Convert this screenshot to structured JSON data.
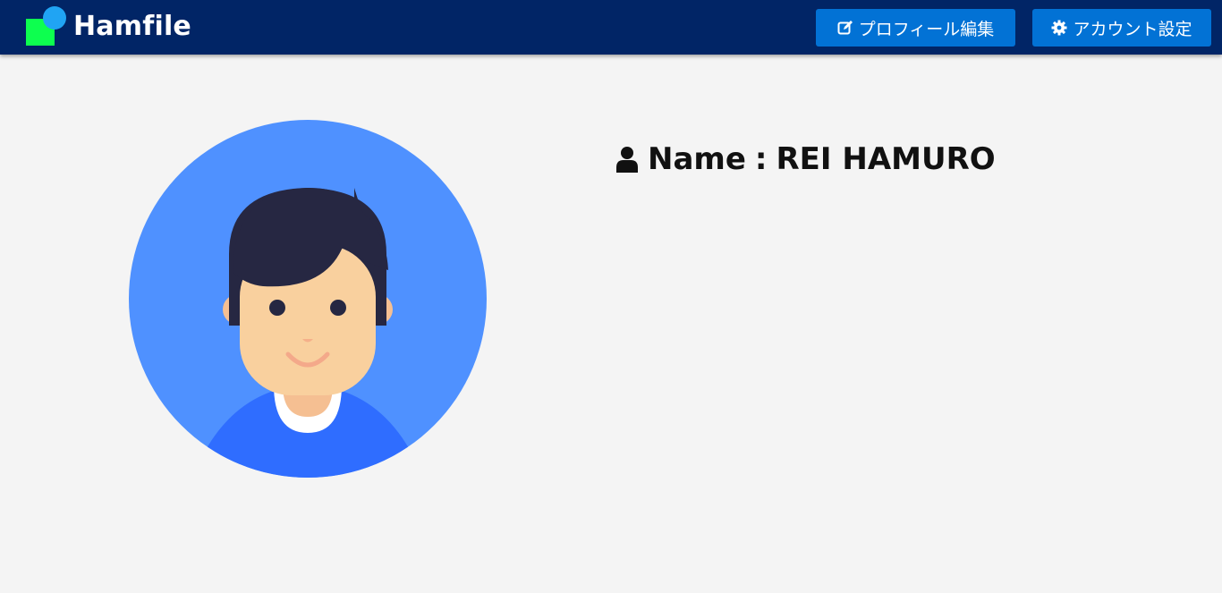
{
  "navbar": {
    "brand_name": "Hamfile",
    "edit_profile_label": "プロフィール編集",
    "edit_profile_icon": "pencil-square-icon",
    "account_settings_label": "アカウント設定",
    "account_settings_icon": "gear-icon"
  },
  "profile": {
    "name_label": "Name",
    "separator": ":",
    "name_value": "REI HAMURO",
    "name_icon": "user-icon"
  },
  "colors": {
    "navbar_bg": "#012566",
    "button_bg": "#0272d5",
    "page_bg": "#f4f4f4",
    "avatar_bg": "#4f91ff",
    "shirt": "#2f6dff",
    "hair": "#262742",
    "skin": "#f9d09e"
  }
}
